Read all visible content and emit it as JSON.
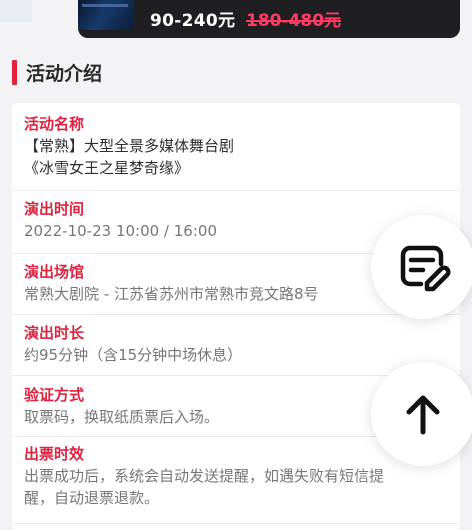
{
  "header": {
    "price_current": "90-240元",
    "price_original": "180-480元"
  },
  "section": {
    "title": "活动介绍"
  },
  "details": [
    {
      "label": "活动名称",
      "lines": [
        "【常熟】大型全景多媒体舞台剧",
        "《冰雪女王之星梦奇缘》"
      ]
    },
    {
      "label": "演出时间",
      "lines": [
        "2022-10-23 10:00 / 16:00"
      ]
    },
    {
      "label": "演出场馆",
      "lines": [
        "常熟大剧院 - 江苏省苏州市常熟市竞文路8号"
      ]
    },
    {
      "label": "演出时长",
      "lines": [
        "约95分钟（含15分钟中场休息）"
      ]
    },
    {
      "label": "验证方式",
      "lines": [
        "取票码，换取纸质票后入场。"
      ]
    },
    {
      "label": "出票时效",
      "lines": [
        "出票成功后，系统会自动发送提醒，如遇失败有短信提",
        "醒，自动退票退款。"
      ]
    }
  ],
  "icons": {
    "edit": "edit-note-icon",
    "top": "arrow-up-icon"
  },
  "colors": {
    "accent": "#e0223f",
    "banner": "#1f1f22",
    "strike": "#ff3b63"
  }
}
